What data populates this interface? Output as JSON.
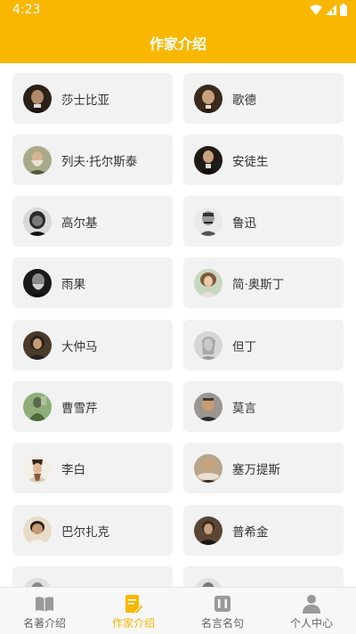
{
  "status_bar": {
    "time": "4:23"
  },
  "header": {
    "title": "作家介绍"
  },
  "colors": {
    "accent": "#f9b701",
    "card": "#f2f2f2",
    "tab_inactive": "#9a9a9a"
  },
  "authors": [
    {
      "name": "莎士比亚",
      "avatar": "portrait-shakespeare"
    },
    {
      "name": "歌德",
      "avatar": "portrait-goethe"
    },
    {
      "name": "列夫·托尔斯泰",
      "avatar": "portrait-tolstoy"
    },
    {
      "name": "安徒生",
      "avatar": "portrait-andersen"
    },
    {
      "name": "高尔基",
      "avatar": "portrait-gorky"
    },
    {
      "name": "鲁迅",
      "avatar": "portrait-luxun"
    },
    {
      "name": "雨果",
      "avatar": "portrait-hugo"
    },
    {
      "name": "简·奥斯丁",
      "avatar": "portrait-austen"
    },
    {
      "name": "大仲马",
      "avatar": "portrait-dumas"
    },
    {
      "name": "但丁",
      "avatar": "portrait-dante"
    },
    {
      "name": "曹雪芹",
      "avatar": "portrait-caoxueqin"
    },
    {
      "name": "莫言",
      "avatar": "portrait-moyan"
    },
    {
      "name": "李白",
      "avatar": "portrait-libai"
    },
    {
      "name": "塞万提斯",
      "avatar": "portrait-cervantes"
    },
    {
      "name": "巴尔扎克",
      "avatar": "portrait-balzac"
    },
    {
      "name": "普希金",
      "avatar": "portrait-pushkin"
    },
    {
      "name": "",
      "avatar": "portrait-partial-1"
    },
    {
      "name": "",
      "avatar": "portrait-partial-2"
    }
  ],
  "tabs": [
    {
      "label": "名著介绍",
      "icon": "book-icon",
      "active": false
    },
    {
      "label": "作家介绍",
      "icon": "writer-edit-icon",
      "active": true
    },
    {
      "label": "名言名句",
      "icon": "quote-scroll-icon",
      "active": false
    },
    {
      "label": "个人中心",
      "icon": "person-icon",
      "active": false
    }
  ]
}
